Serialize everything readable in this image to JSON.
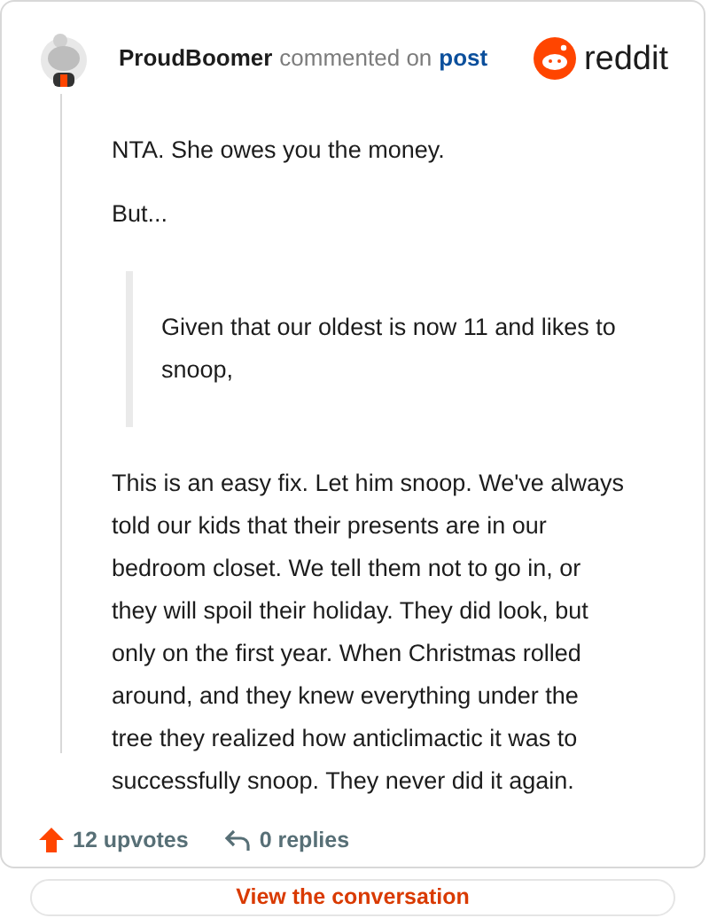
{
  "header": {
    "author": "ProudBoomer",
    "action": "commented on",
    "link": "post",
    "brand": "reddit"
  },
  "body": [
    {
      "kind": "paragraph",
      "text": "NTA. She owes you the money."
    },
    {
      "kind": "paragraph",
      "text": "But..."
    },
    {
      "kind": "quote",
      "text": "Given that our oldest is now 11 and likes to snoop,"
    },
    {
      "kind": "paragraph",
      "text": "This is an easy fix. Let him snoop. We've always told our kids that their presents are in our bedroom closet. We tell them not to go in, or they will spoil their holiday. They did look, but only on the first year. When Christmas rolled around, and they knew everything under the tree they realized how anticlimactic it was to successfully snoop. They never did it again."
    }
  ],
  "footer": {
    "upvotes": "12 upvotes",
    "replies": "0 replies",
    "button": "View the conversation"
  }
}
